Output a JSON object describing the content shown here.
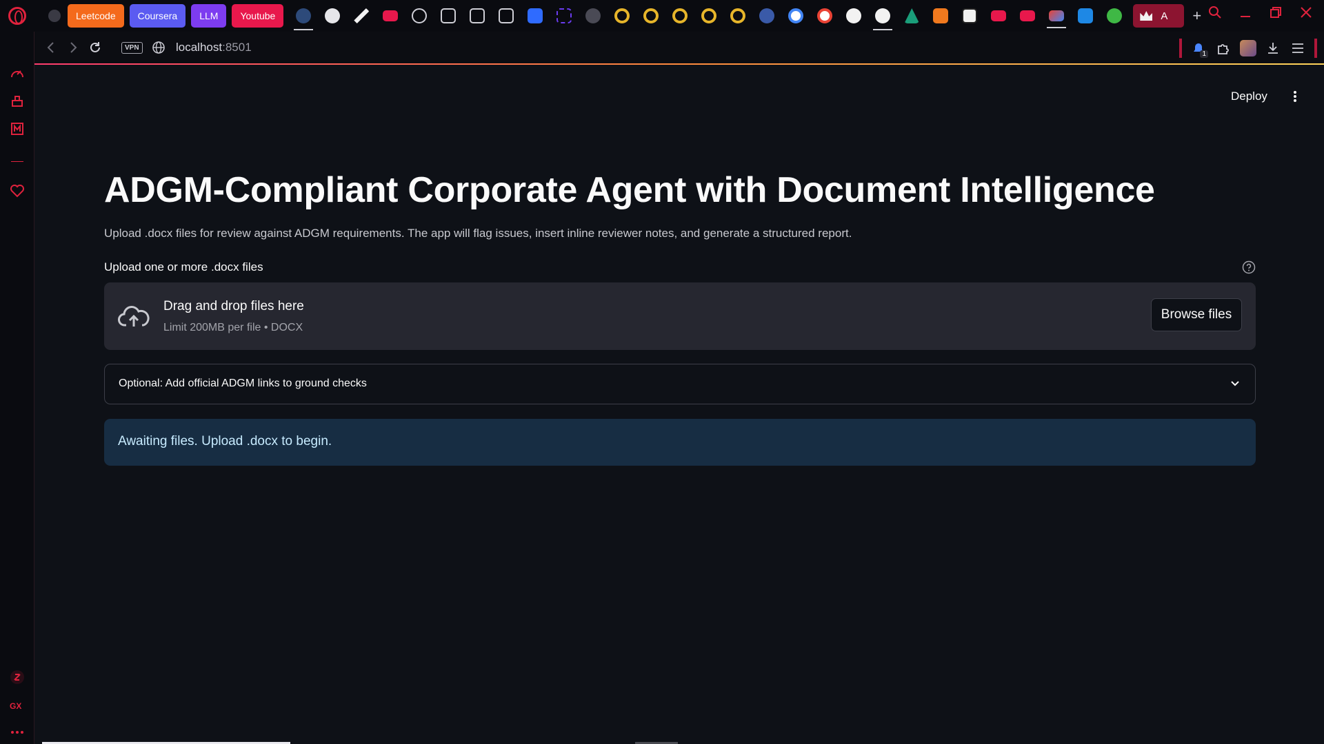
{
  "tabbar": {
    "groups": [
      {
        "label": "Leetcode",
        "color": "#f46a1c"
      },
      {
        "label": "Coursera",
        "color": "#5b5bf1"
      },
      {
        "label": "LLM",
        "color": "#7d3cf0"
      },
      {
        "label": "Youtube",
        "color": "#e8184c"
      }
    ],
    "active_tab_label": "A",
    "new_tab_symbol": "+"
  },
  "addressbar": {
    "vpn_label": "VPN",
    "host": "localhost",
    "port": ":8501"
  },
  "extensions": {
    "badge_count": "1"
  },
  "app_header": {
    "deploy_label": "Deploy"
  },
  "main": {
    "title": "ADGM-Compliant Corporate Agent with Document Intelligence",
    "intro": "Upload .docx files for review against ADGM requirements. The app will flag issues, insert inline reviewer notes, and generate a structured report.",
    "uploader": {
      "label": "Upload one or more .docx files",
      "drop_title": "Drag and drop files here",
      "drop_subtitle": "Limit 200MB per file • DOCX",
      "browse_label": "Browse files"
    },
    "expander_label": "Optional: Add official ADGM links to ground checks",
    "info_message": "Awaiting files. Upload .docx to begin."
  },
  "sidebar_bottom": {
    "gx_label": "GX"
  }
}
